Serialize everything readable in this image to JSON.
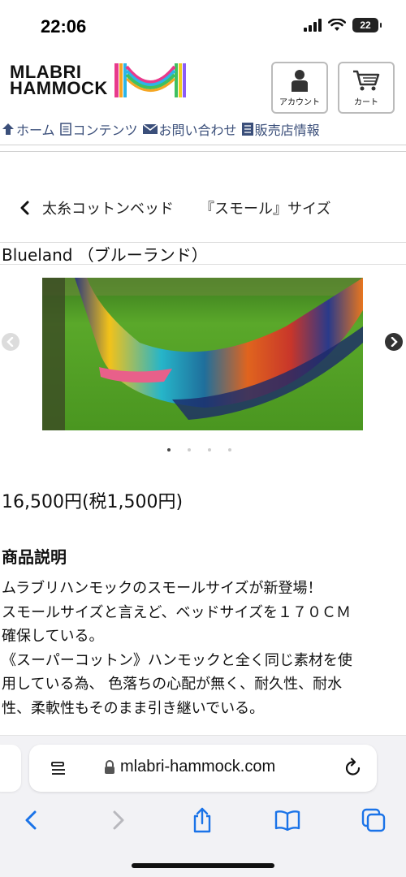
{
  "status_bar": {
    "time": "22:06",
    "battery": "22"
  },
  "header": {
    "logo_line1": "MLABRI",
    "logo_line2": "HAMMOCK",
    "account_label": "アカウント",
    "cart_label": "カート"
  },
  "nav": {
    "items": [
      {
        "label": "ホーム",
        "icon": "home-arrow-icon"
      },
      {
        "label": "コンテンツ",
        "icon": "document-icon"
      },
      {
        "label": "お問い合わせ",
        "icon": "mail-icon"
      },
      {
        "label": "販売店情報",
        "icon": "list-book-icon"
      }
    ]
  },
  "breadcrumb": {
    "title": "太糸コットンベッド",
    "size": "『スモール』サイズ"
  },
  "product": {
    "name": "Blueland （ブルーランド）",
    "price": "16,500円(税1,500円)",
    "carousel": {
      "slide_count": 4,
      "active_index": 0
    },
    "description_title": "商品説明",
    "description_lines": [
      "ムラブリハンモックのスモールサイズが新登場！",
      "スモールサイズと言えど、ベッドサイズを１７０ＣＭ",
      "確保している。",
      "《スーパーコットン》ハンモックと全く同じ素材を使",
      "用している為、 色落ちの心配が無く、耐久性、耐水",
      "性、柔軟性もそのまま引き継いでいる。"
    ]
  },
  "browser": {
    "url": "mlabri-hammock.com"
  },
  "colors": {
    "nav_text": "#3b4f7a",
    "ios_blue": "#1a73e8",
    "toolbar_bg": "#f2f2f5"
  }
}
